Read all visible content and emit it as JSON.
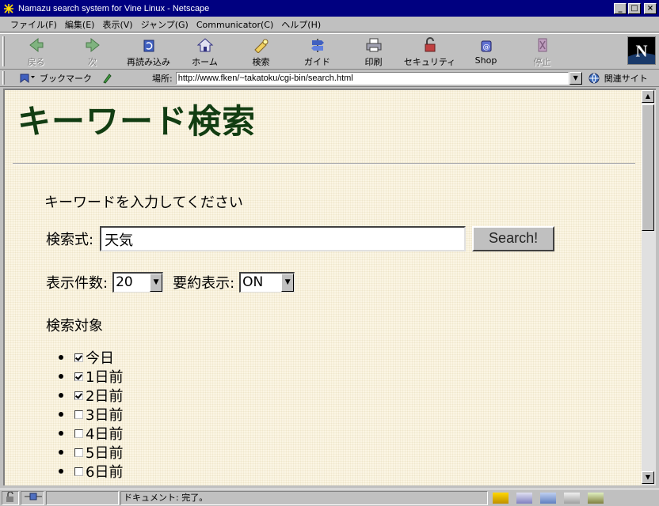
{
  "window": {
    "title": "Namazu search system for Vine Linux - Netscape",
    "min": "_",
    "max": "□",
    "close": "×"
  },
  "menu": [
    "ファイル(F)",
    "編集(E)",
    "表示(V)",
    "ジャンプ(G)",
    "Communicator(C)",
    "ヘルプ(H)"
  ],
  "toolbar": {
    "back": "戻る",
    "forward": "次",
    "reload": "再読み込み",
    "home": "ホーム",
    "search": "検索",
    "guide": "ガイド",
    "print": "印刷",
    "security": "セキュリティ",
    "shop": "Shop",
    "stop": "停止"
  },
  "location": {
    "bookmarks": "ブックマーク",
    "label": "場所:",
    "url": "http://www.fken/~takatoku/cgi-bin/search.html",
    "related": "関連サイト"
  },
  "page": {
    "heading": "キーワード検索",
    "instruction": "キーワードを入力してください",
    "query_label": "検索式:",
    "query_value": "天気",
    "search_button": "Search!",
    "count_label": "表示件数:",
    "count_value": "20",
    "summary_label": "要約表示:",
    "summary_value": "ON",
    "target_label": "検索対象",
    "targets": [
      {
        "label": "今日",
        "checked": true
      },
      {
        "label": "1日前",
        "checked": true
      },
      {
        "label": "2日前",
        "checked": true
      },
      {
        "label": "3日前",
        "checked": false
      },
      {
        "label": "4日前",
        "checked": false
      },
      {
        "label": "5日前",
        "checked": false
      },
      {
        "label": "6日前",
        "checked": false
      }
    ]
  },
  "status": {
    "text": "ドキュメント: 完了。"
  },
  "colors": {
    "titlebar": "#000080",
    "heading": "#123d12",
    "page_bg": "#fbf5e4"
  }
}
